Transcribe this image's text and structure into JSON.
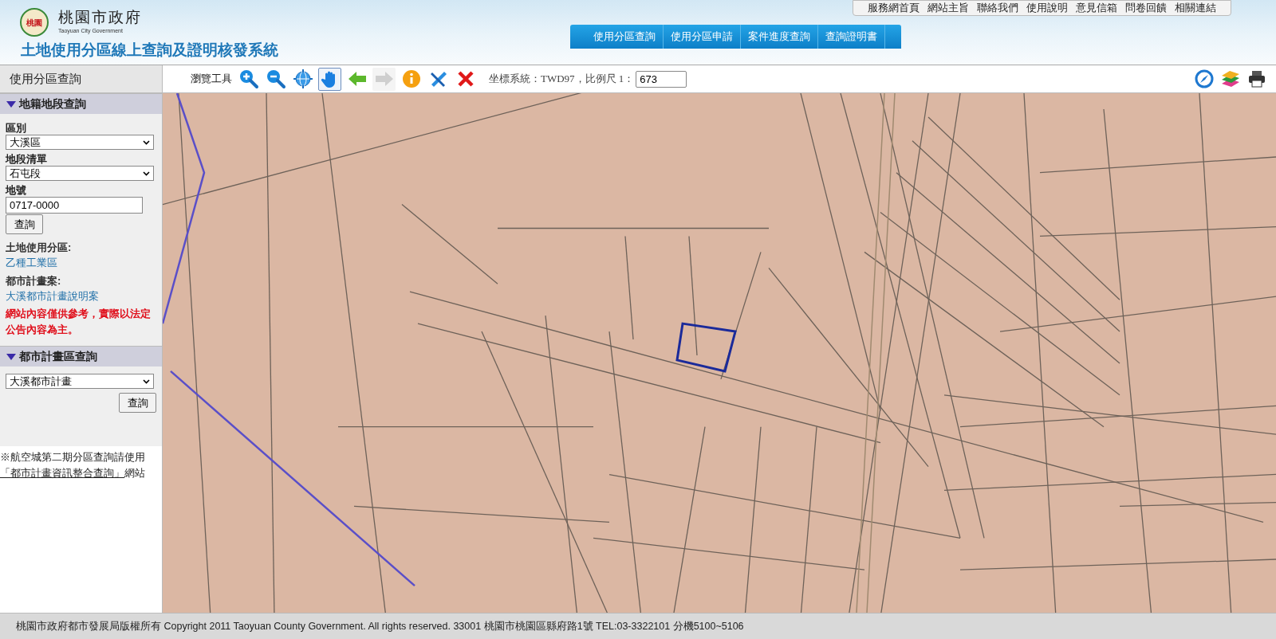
{
  "header": {
    "org_name": "桃園市政府",
    "org_name_en": "Taoyuan City Government",
    "logo_text": "桃園",
    "system_title": "土地使用分區線上查詢及證明核發系統"
  },
  "top_links": [
    "服務網首頁",
    "網站主旨",
    "聯絡我們",
    "使用說明",
    "意見信箱",
    "問卷回饋",
    "相關連結"
  ],
  "nav_tabs": [
    "使用分區查詢",
    "使用分區申請",
    "案件進度查詢",
    "查詢證明書"
  ],
  "sidebar": {
    "title": "使用分區查詢",
    "sections": [
      {
        "title": "地籍地段查詢",
        "expanded": true
      },
      {
        "title": "都市計畫區查詢",
        "expanded": true
      }
    ],
    "district": {
      "label": "區別",
      "value": "大溪區"
    },
    "section_list": {
      "label": "地段清單",
      "value": "石屯段"
    },
    "lot_number": {
      "label": "地號",
      "value": "0717-0000"
    },
    "query_button": "查詢",
    "zoning": {
      "label": "土地使用分區:",
      "value": "乙種工業區"
    },
    "plan": {
      "label": "都市計畫案:",
      "value": "大溪都市計畫說明案"
    },
    "disclaimer": "網站內容僅供參考，實際以法定公告內容為主。",
    "plan_select": "大溪都市計畫",
    "plan_query_button": "查詢",
    "note": {
      "text": "※航空城第二期分區查詢請使用",
      "link": "「都市計畫資訊整合查詢」",
      "suffix": "網站"
    }
  },
  "toolbar": {
    "label": "瀏覽工具",
    "tools": [
      {
        "kind": "zoom-in",
        "selected": false,
        "disabled": false
      },
      {
        "kind": "zoom-out",
        "selected": false,
        "disabled": false
      },
      {
        "kind": "full-extent",
        "selected": false,
        "disabled": false
      },
      {
        "kind": "pan",
        "selected": true,
        "disabled": false
      },
      {
        "kind": "back",
        "selected": false,
        "disabled": false
      },
      {
        "kind": "forward",
        "selected": false,
        "disabled": true
      },
      {
        "kind": "info",
        "selected": false,
        "disabled": false
      },
      {
        "kind": "measure",
        "selected": false,
        "disabled": false
      },
      {
        "kind": "clear",
        "selected": false,
        "disabled": false
      }
    ],
    "coordinate_text": "坐標系統：TWD97，比例尺 1：",
    "scale": "673"
  },
  "footer": "桃園市政府都市發展局版權所有 Copyright 2011 Taoyuan County Government. All rights reserved. 33001 桃園市桃園區縣府路1號 TEL:03-3322101 分機5100~5106"
}
